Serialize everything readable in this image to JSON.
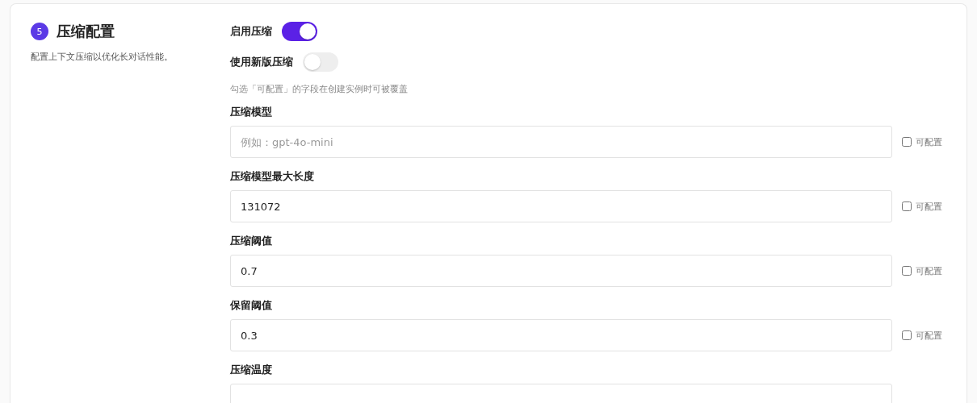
{
  "section": {
    "number": "5",
    "title": "压缩配置",
    "description": "配置上下文压缩以优化长对话性能。"
  },
  "toggles": [
    {
      "label": "启用压缩",
      "on": true
    },
    {
      "label": "使用新版压缩",
      "on": false
    }
  ],
  "hint": "勾选「可配置」的字段在创建实例时可被覆盖",
  "fields": [
    {
      "label": "压缩模型",
      "placeholder": "例如：gpt-4o-mini",
      "configurable_label": "可配置",
      "checked": false
    },
    {
      "label": "压缩模型最大长度",
      "value": "131072",
      "configurable_label": "可配置",
      "checked": false
    },
    {
      "label": "压缩阈值",
      "value": "0.7",
      "configurable_label": "可配置",
      "checked": false
    },
    {
      "label": "保留阈值",
      "value": "0.3",
      "configurable_label": "可配置",
      "checked": false
    },
    {
      "label": "压缩温度"
    }
  ]
}
